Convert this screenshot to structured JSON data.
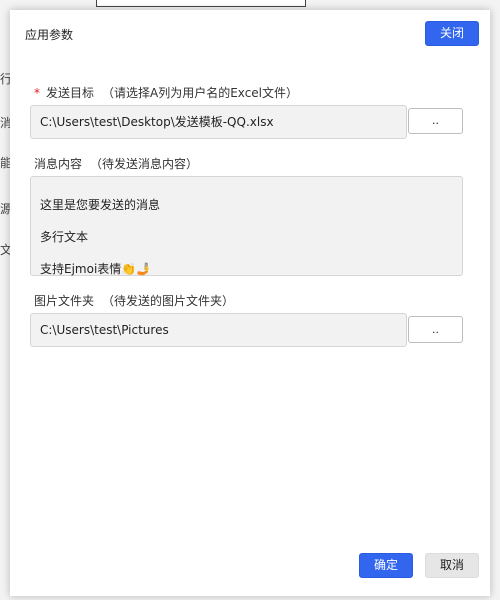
{
  "dialog": {
    "title": "应用参数",
    "close_label": "关闭",
    "ok_label": "确定",
    "cancel_label": "取消"
  },
  "target": {
    "required_mark": "*",
    "label": "发送目标",
    "hint": "（请选择A列为用户名的Excel文件）",
    "value": "C:\\Users\\test\\Desktop\\发送模板-QQ.xlsx",
    "browse_label": ".."
  },
  "message": {
    "label": "消息内容",
    "hint": "（待发送消息内容）",
    "lines": [
      "这里是您要发送的消息",
      "多行文本",
      "支持Ejmoi表情"
    ],
    "emoji": "👏🤳"
  },
  "images": {
    "label": "图片文件夹",
    "hint": "（待发送的图片文件夹）",
    "value": "C:\\Users\\test\\Pictures",
    "browse_label": ".."
  },
  "background": {
    "fragments": [
      "行",
      "消",
      "能",
      "源",
      "文"
    ]
  },
  "colors": {
    "primary": "#3366ee",
    "required": "#e02020",
    "input_bg": "#f2f2f2"
  }
}
